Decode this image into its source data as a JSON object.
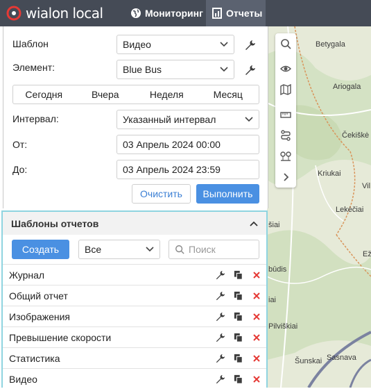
{
  "header": {
    "logo_text": "wialon local",
    "tabs": [
      {
        "label": "Мониторинг",
        "icon": "globe-icon",
        "active": false
      },
      {
        "label": "Отчеты",
        "icon": "report-icon",
        "active": true
      }
    ]
  },
  "report_form": {
    "template_label": "Шаблон",
    "template_value": "Видео",
    "element_label": "Элемент:",
    "element_value": "Blue Bus",
    "quick_periods": [
      "Сегодня",
      "Вчера",
      "Неделя",
      "Месяц"
    ],
    "interval_label": "Интервал:",
    "interval_value": "Указанный интервал",
    "from_label": "От:",
    "from_value": "03 Апрель 2024 00:00",
    "to_label": "До:",
    "to_value": "03 Апрель 2024 23:59",
    "clear_label": "Очистить",
    "run_label": "Выполнить"
  },
  "templates_panel": {
    "title": "Шаблоны отчетов",
    "create_label": "Создать",
    "filter_value": "Все",
    "search_placeholder": "Поиск",
    "items": [
      "Журнал",
      "Общий отчет",
      "Изображения",
      "Превышение скорости",
      "Статистика",
      "Видео"
    ]
  },
  "map": {
    "labels": [
      "Betygala",
      "Ariogala",
      "Čekiškė",
      "Kriukai",
      "Vil",
      "Lekėčiai",
      "šiai",
      "Ež",
      "būdis",
      "iai",
      "Pilviškiai",
      "Šunskai",
      "Sasnava"
    ]
  },
  "colors": {
    "accent": "#4a90e2",
    "topbar": "#454b56",
    "delete": "#e53935",
    "highlight": "#8fd4e0"
  }
}
